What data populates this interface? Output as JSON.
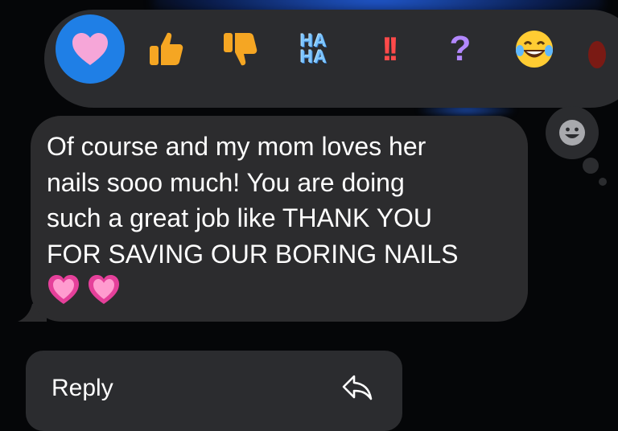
{
  "tapbacks": {
    "items": [
      {
        "icon": "heart-icon",
        "selected": true
      },
      {
        "icon": "thumbs-up-icon"
      },
      {
        "icon": "thumbs-down-icon"
      },
      {
        "icon": "haha-icon",
        "line1": "HA",
        "line2": "HA"
      },
      {
        "icon": "exclamation-icon",
        "text": "!!"
      },
      {
        "icon": "question-icon",
        "text": "?"
      },
      {
        "icon": "laughing-emoji-icon"
      }
    ],
    "selected_color": "#1f7fe6"
  },
  "message": {
    "lines": [
      "Of course and my mom loves her",
      "nails sooo much! You are doing",
      "such a great job like THANK YOU",
      "FOR SAVING OUR BORING NAILS"
    ],
    "emoji": [
      "pink-heart-icon",
      "pink-heart-icon"
    ]
  },
  "actions": {
    "reply_label": "Reply",
    "reply_icon": "reply-arrow-icon"
  },
  "colors": {
    "background": "#050608",
    "bubble": "#2c2c2e",
    "accent": "#1f7fe6"
  }
}
